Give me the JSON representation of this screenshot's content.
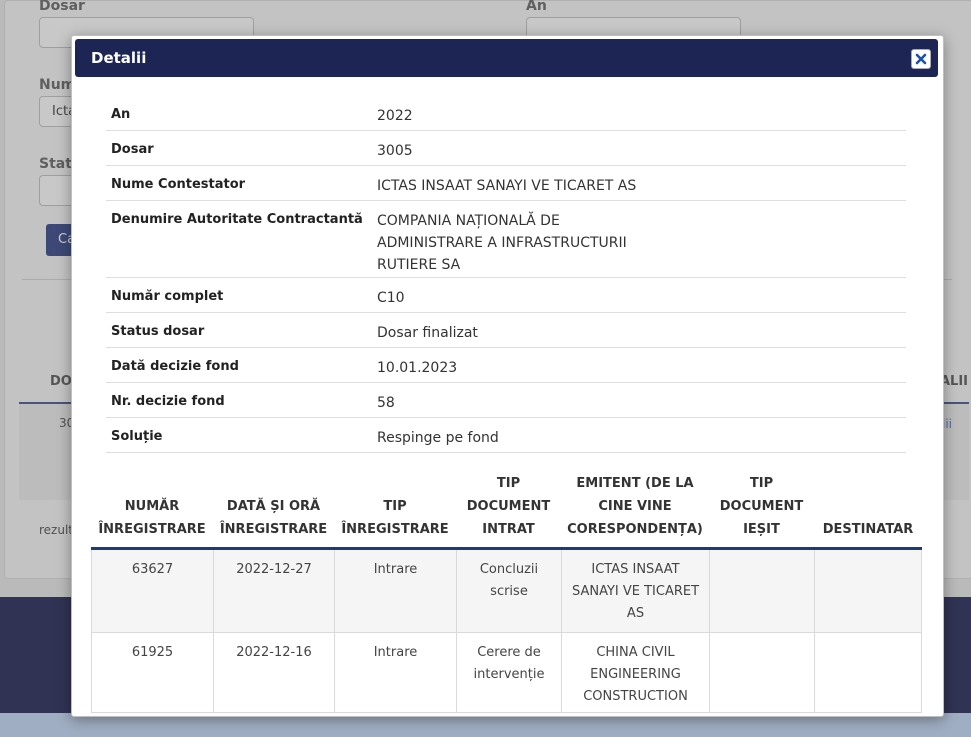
{
  "background": {
    "labels": {
      "dosar": "Dosar",
      "an": "An",
      "numar_partial": "Num",
      "status_partial": "Statu"
    },
    "inputs": {
      "nume_partial": "Icta"
    },
    "search_button_partial": "Ca",
    "table_headers": {
      "left_partial": "DO",
      "right_partial": "ALII"
    },
    "table_row": {
      "number_partial": "30",
      "link_partial": "lii"
    },
    "results_partial": "rezult"
  },
  "modal": {
    "title": "Detalii",
    "details": [
      {
        "label": "An",
        "value": "2022"
      },
      {
        "label": "Dosar",
        "value": "3005"
      },
      {
        "label": "Nume Contestator",
        "value": "ICTAS INSAAT SANAYI VE TICARET AS"
      },
      {
        "label": "Denumire Autoritate Contractantă",
        "value": "COMPANIA NAȚIONALĂ DE\nADMINISTRARE A INFRASTRUCTURII\nRUTIERE SA"
      },
      {
        "label": "Număr complet",
        "value": "C10"
      },
      {
        "label": "Status dosar",
        "value": "Dosar finalizat"
      },
      {
        "label": "Dată decizie fond",
        "value": "10.01.2023"
      },
      {
        "label": "Nr. decizie fond",
        "value": "58"
      },
      {
        "label": "Soluție",
        "value": "Respinge pe fond"
      }
    ],
    "register": {
      "headers": [
        "NUMĂR\nÎNREGISTRARE",
        "DATĂ ȘI ORĂ\nÎNREGISTRARE",
        "TIP\nÎNREGISTRARE",
        "TIP\nDOCUMENT\nINTRAT",
        "EMITENT (DE LA\nCINE VINE\nCORESPONDENȚA)",
        "TIP\nDOCUMENT\nIEȘIT",
        "DESTINATAR"
      ],
      "rows": [
        [
          "63627",
          "2022-12-27",
          "Intrare",
          "Concluzii\nscrise",
          "ICTAS INSAAT\nSANAYI VE TICARET\nAS",
          "",
          ""
        ],
        [
          "61925",
          "2022-12-16",
          "Intrare",
          "Cerere de\nintervenție",
          "CHINA CIVIL\nENGINEERING\nCONSTRUCTION",
          "",
          ""
        ]
      ]
    }
  }
}
